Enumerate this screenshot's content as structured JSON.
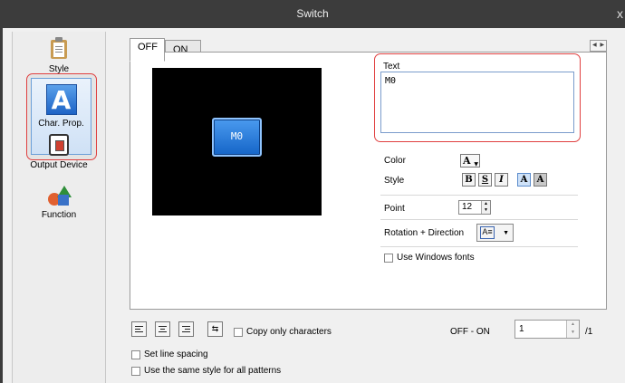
{
  "window": {
    "title": "Switch",
    "close_glyph": "x"
  },
  "sidebar": {
    "items": [
      {
        "label": "Style",
        "icon": "clipboard-icon"
      },
      {
        "label": "Char. Prop.",
        "icon": "char-prop-icon",
        "selected": true,
        "icon_glyph": "A"
      },
      {
        "label": "Output Device",
        "icon": "output-device-icon"
      },
      {
        "label": "Function",
        "icon": "function-icon"
      }
    ]
  },
  "tabs": [
    {
      "label": "OFF",
      "active": true
    },
    {
      "label": "ON",
      "active": false
    }
  ],
  "preview": {
    "button_text": "M0"
  },
  "text_group": {
    "label": "Text",
    "value": "M0"
  },
  "color": {
    "label": "Color",
    "glyph": "A"
  },
  "style": {
    "label": "Style",
    "buttons": [
      {
        "glyph": "B",
        "name": "bold"
      },
      {
        "glyph": "S",
        "name": "shadow"
      },
      {
        "glyph": "I",
        "name": "italic"
      },
      {
        "glyph": "A",
        "name": "normal",
        "active": true
      },
      {
        "glyph": "A",
        "name": "background"
      }
    ]
  },
  "point": {
    "label": "Point",
    "value": "12"
  },
  "rotation": {
    "label": "Rotation + Direction"
  },
  "windows_fonts": {
    "label": "Use Windows fonts",
    "checked": false
  },
  "copy_only": {
    "label": "Copy only characters",
    "checked": false
  },
  "set_line_spacing": {
    "label": "Set line spacing",
    "checked": false
  },
  "same_style": {
    "label": "Use the same style for all patterns",
    "checked": false
  },
  "pattern": {
    "label": "OFF - ON",
    "value": "1",
    "total": "/1"
  },
  "colors": {
    "accent_red": "#e04040",
    "button_blue": "#1d6fd6",
    "titlebar": "#3c3c3c"
  }
}
